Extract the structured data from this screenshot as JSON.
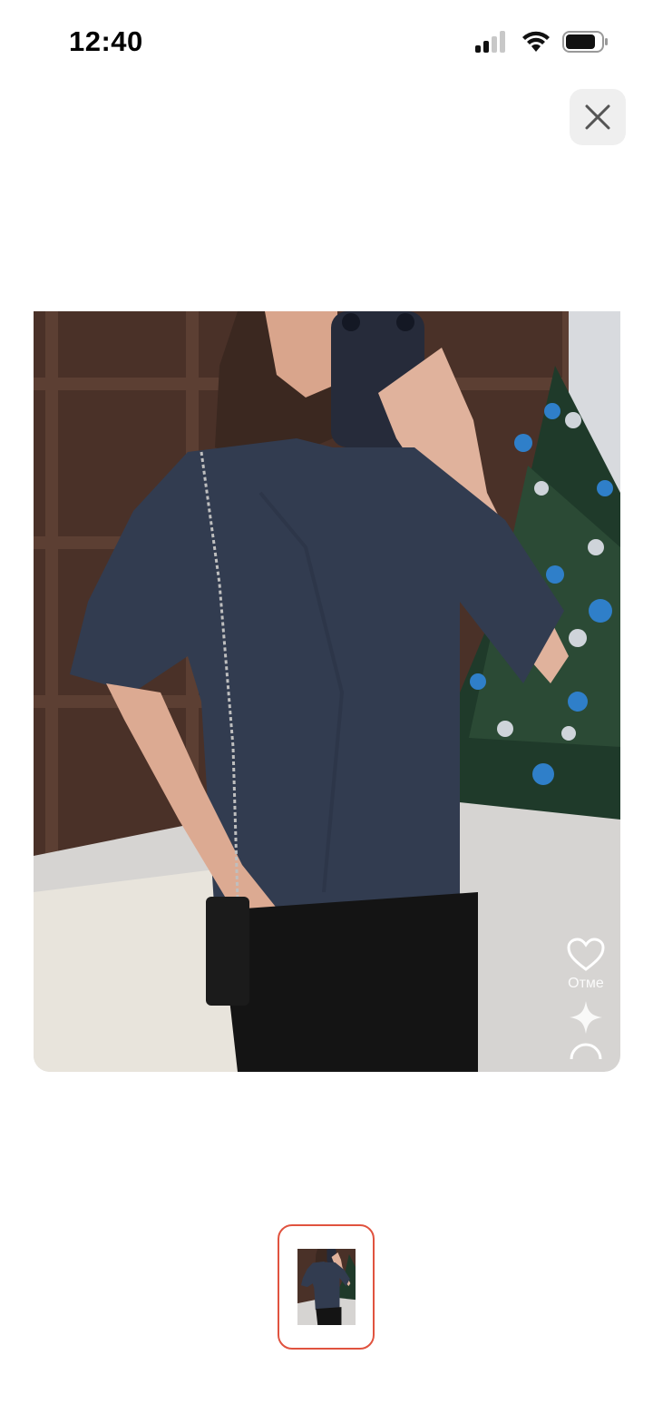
{
  "status_bar": {
    "time": "12:40",
    "icons": [
      "cellular-signal-icon",
      "wifi-icon",
      "battery-icon"
    ]
  },
  "viewer": {
    "close_icon": "close-icon",
    "like_icon": "heart-icon",
    "like_label": "Отме",
    "image_subject": "product-photo-navy-tshirt",
    "thumbnails": [
      {
        "selected": true
      }
    ]
  },
  "colors": {
    "selected_thumbnail_border": "#e0533f",
    "close_button_bg": "#efefef",
    "shirt_navy": "#323c50"
  }
}
